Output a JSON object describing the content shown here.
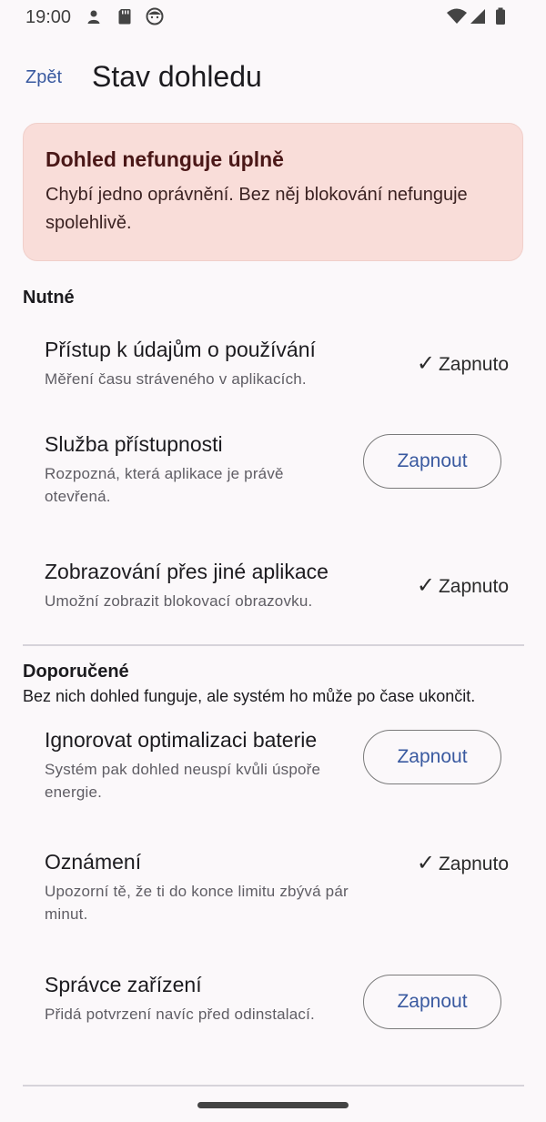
{
  "status_bar": {
    "time": "19:00"
  },
  "header": {
    "back_label": "Zpět",
    "title": "Stav dohledu"
  },
  "warning": {
    "title": "Dohled nefunguje úplně",
    "text": "Chybí jedno oprávnění. Bez něj blokování nefunguje spolehlivě."
  },
  "required": {
    "title": "Nutné",
    "items": [
      {
        "title": "Přístup k údajům o používání",
        "description": "Měření času stráveného v aplikacích.",
        "status": "Zapnuto"
      },
      {
        "title": "Služba přístupnosti",
        "description": "Rozpozná, která aplikace je právě otevřená.",
        "action": "Zapnout"
      },
      {
        "title": "Zobrazování přes jiné aplikace",
        "description": "Umožní zobrazit blokovací obrazovku.",
        "status": "Zapnuto"
      }
    ]
  },
  "recommended": {
    "title": "Doporučené",
    "subtitle": "Bez nich dohled funguje, ale systém ho může po čase ukončit.",
    "items": [
      {
        "title": "Ignorovat optimalizaci baterie",
        "description": "Systém pak dohled neuspí kvůli úspoře energie.",
        "action": "Zapnout"
      },
      {
        "title": "Oznámení",
        "description": "Upozorní tě, že ti do konce limitu zbývá pár minut.",
        "status": "Zapnuto"
      },
      {
        "title": "Správce zařízení",
        "description": "Přidá potvrzení navíc před odinstalací.",
        "action": "Zapnout"
      }
    ]
  },
  "icons": {
    "check": "✓"
  }
}
